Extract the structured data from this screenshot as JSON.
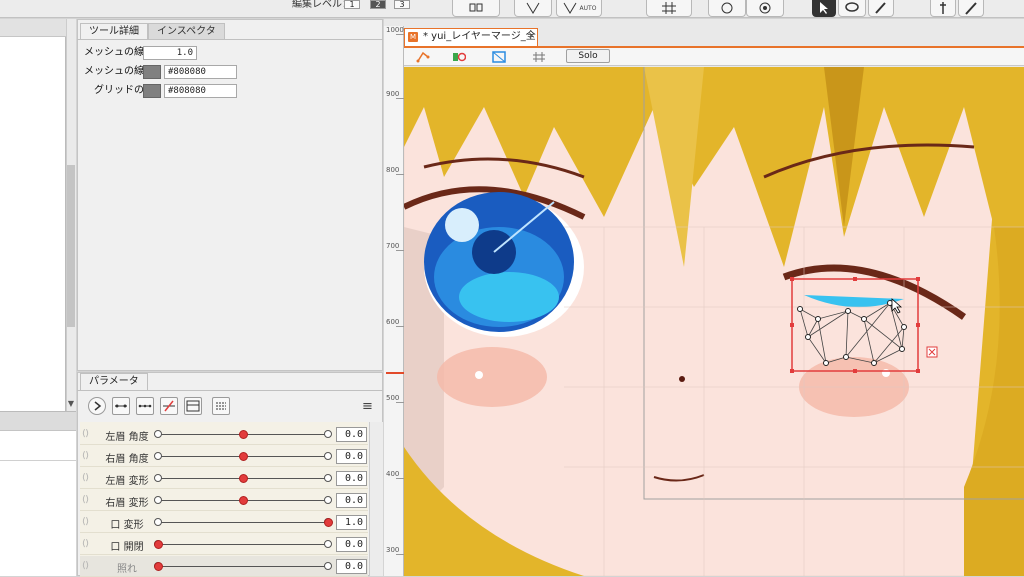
{
  "toolbar": {
    "edit_level_label": "編集レベル：",
    "levels": [
      "1",
      "2",
      "3"
    ],
    "active_level": "2",
    "auto_label": "AUTO",
    "icons": [
      "deformer-icon",
      "mesh-edit-icon",
      "auto-mesh-icon",
      "grid-mesh-icon",
      "rotate-tool-icon",
      "transform-tool-icon",
      "arrow-select-icon",
      "lasso-icon",
      "brush-tool-icon",
      "pen-icon",
      "ink-pen-icon"
    ]
  },
  "tool_details": {
    "tabs": [
      "ツール詳細",
      "インスペクタ"
    ],
    "active_tab": "ツール詳細",
    "mesh_line_width_label": "メッシュの線幅",
    "mesh_line_width_value": "1.0",
    "mesh_line_color_label": "メッシュの線色",
    "mesh_line_color_value": "#808080",
    "grid_color_label": "グリッドの色",
    "grid_color_value": "#808080"
  },
  "parameters": {
    "tab_label": "パラメータ",
    "menu_icon": "hamburger-menu-icon",
    "rows": [
      {
        "name": "左眉 角度",
        "value": "0.0",
        "knob": 0.5
      },
      {
        "name": "右眉 角度",
        "value": "0.0",
        "knob": 0.5
      },
      {
        "name": "左眉 変形",
        "value": "0.0",
        "knob": 0.5
      },
      {
        "name": "右眉 変形",
        "value": "0.0",
        "knob": 0.5
      },
      {
        "name": "口 変形",
        "value": "1.0",
        "knob": 1.0
      },
      {
        "name": "口 開閉",
        "value": "0.0",
        "knob": 0.0
      },
      {
        "name": "照れ",
        "value": "0.0",
        "knob": 0.0
      }
    ]
  },
  "canvas": {
    "doc_tab_label": "* yui_レイヤーマージ_全",
    "close_label": "×",
    "solo_label": "Solo",
    "ruler_labels": [
      "1000",
      "900",
      "800",
      "700",
      "600",
      "500",
      "400",
      "300"
    ],
    "colors": {
      "accent": "#e8732a",
      "hair": "#e3b52a",
      "skin": "#fbe2db",
      "eye_blue": "#2a8be0",
      "selection": "#e23c3c"
    }
  }
}
